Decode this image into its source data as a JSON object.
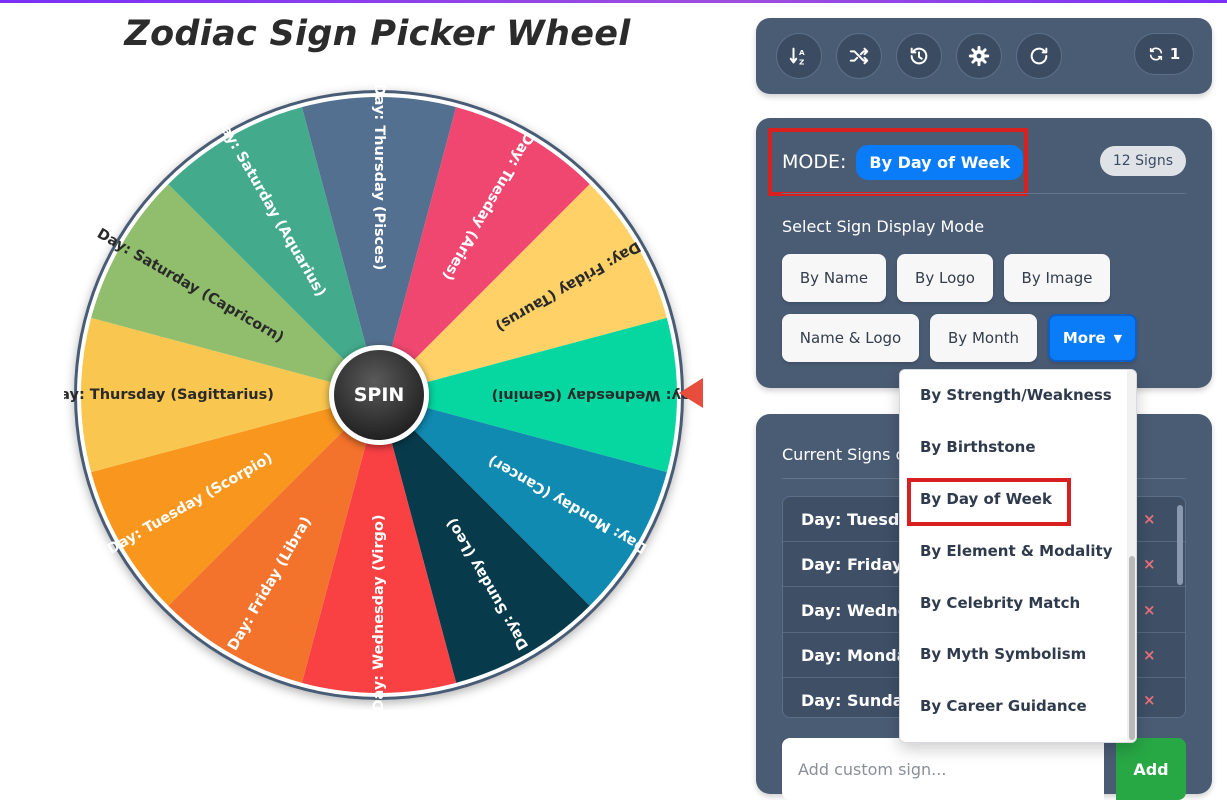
{
  "page": {
    "title": "Zodiac Sign Picker Wheel"
  },
  "wheel": {
    "spin_label": "SPIN",
    "segments": [
      {
        "label": "Day: Thursday (Pisces)",
        "color": "#547090"
      },
      {
        "label": "Day: Tuesday (Aries)",
        "color": "#ef4770"
      },
      {
        "label": "Day: Friday (Taurus)",
        "color": "#ffd166"
      },
      {
        "label": "Day: Wednesday (Gemini)",
        "color": "#06d6a0"
      },
      {
        "label": "Day: Monday (Cancer)",
        "color": "#118ab2"
      },
      {
        "label": "Day: Sunday (Leo)",
        "color": "#073b4c"
      },
      {
        "label": "Day: Wednesday (Virgo)",
        "color": "#f94144"
      },
      {
        "label": "Day: Friday (Libra)",
        "color": "#f3722c"
      },
      {
        "label": "Day: Tuesday (Scorpio)",
        "color": "#f8961e"
      },
      {
        "label": "Day: Thursday (Sagittarius)",
        "color": "#f9c74f"
      },
      {
        "label": "Day: Saturday (Capricorn)",
        "color": "#90be6d"
      },
      {
        "label": "Day: Saturday (Aquarius)",
        "color": "#43aa8b"
      }
    ],
    "pointer_color": "#e74c3c"
  },
  "toolbar": {
    "buttons": [
      "sort-icon",
      "shuffle-icon",
      "history-icon",
      "gear-icon",
      "redo-icon"
    ],
    "counter": "1"
  },
  "mode_panel": {
    "mode_label": "MODE:",
    "mode_value": "By Day of Week",
    "signs_count": "12 Signs",
    "select_label": "Select Sign Display Mode",
    "buttons": [
      "By Name",
      "By Logo",
      "By Image",
      "Name & Logo",
      "By Month"
    ],
    "more_label": "More"
  },
  "dropdown": {
    "items": [
      "By Strength/Weakness",
      "By Birthstone",
      "By Day of Week",
      "By Element & Modality",
      "By Celebrity Match",
      "By Myth Symbolism",
      "By Career Guidance"
    ],
    "selected": "By Day of Week"
  },
  "signs_panel": {
    "title": "Current Signs o",
    "rows": [
      "Day: Tuesda",
      "Day: Friday",
      "Day: Wedne",
      "Day: Monda",
      "Day: Sunday"
    ],
    "remove_symbol": "×",
    "add_placeholder": "Add custom sign...",
    "add_label": "Add"
  },
  "colors": {
    "accent_blue": "#0b7cf7",
    "panel_bg": "#4a5c74",
    "highlight_red": "#d7201f",
    "add_green": "#28a745"
  }
}
